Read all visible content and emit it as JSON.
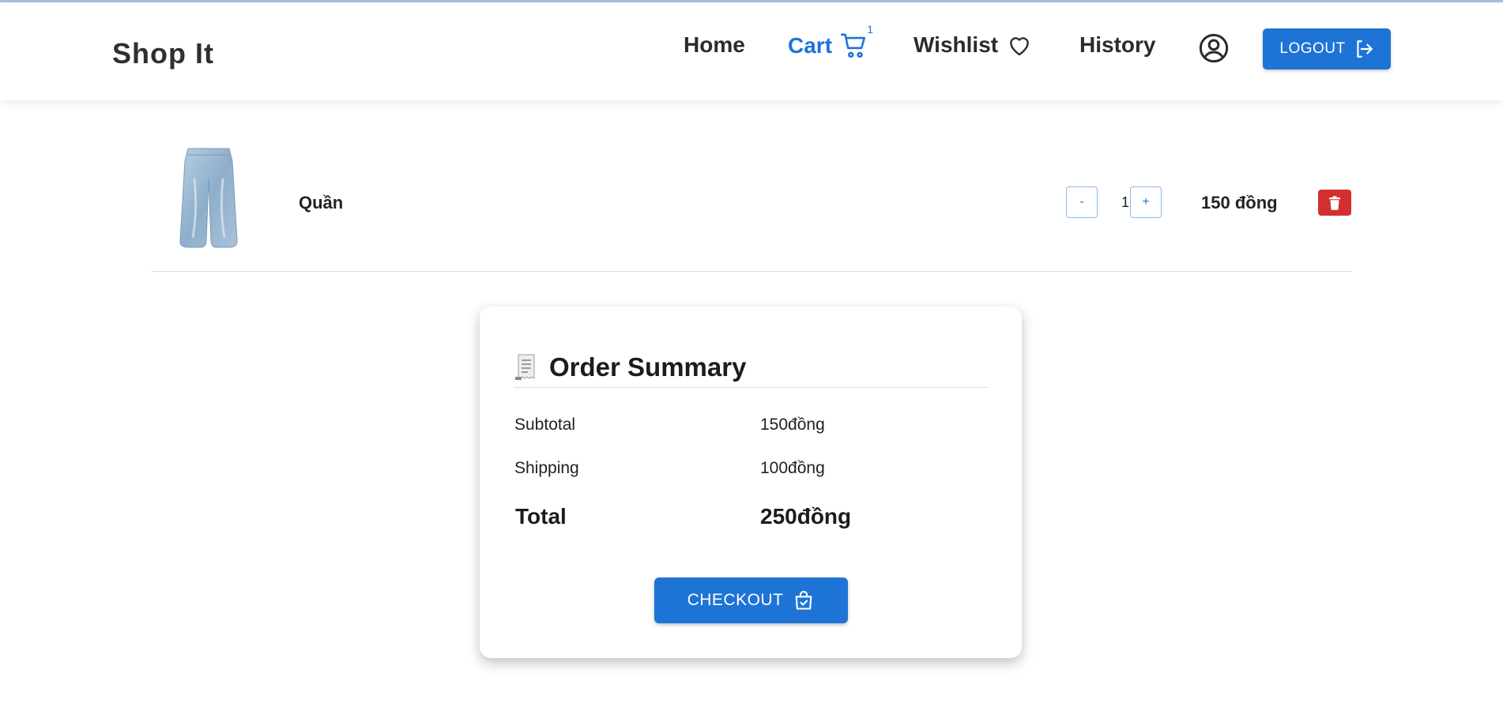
{
  "header": {
    "brand": "Shop It",
    "nav": {
      "home": "Home",
      "cart": "Cart",
      "cart_count": "1",
      "wishlist": "Wishlist",
      "history": "History"
    },
    "logout_label": "LOGOUT"
  },
  "cart": {
    "items": [
      {
        "name": "Quần",
        "quantity": "1",
        "minus_label": "-",
        "plus_label": "+",
        "price": "150 đồng",
        "image_icon": "jeans-image"
      }
    ]
  },
  "summary": {
    "icon": "receipt-icon",
    "title": "Order Summary",
    "subtotal_label": "Subtotal",
    "subtotal_value": "150đồng",
    "shipping_label": "Shipping",
    "shipping_value": "100đồng",
    "total_label": "Total",
    "total_value": "250đồng",
    "checkout_label": "CHECKOUT"
  },
  "colors": {
    "primary": "#1e74d6",
    "danger": "#d32f2f",
    "text": "#222222"
  }
}
